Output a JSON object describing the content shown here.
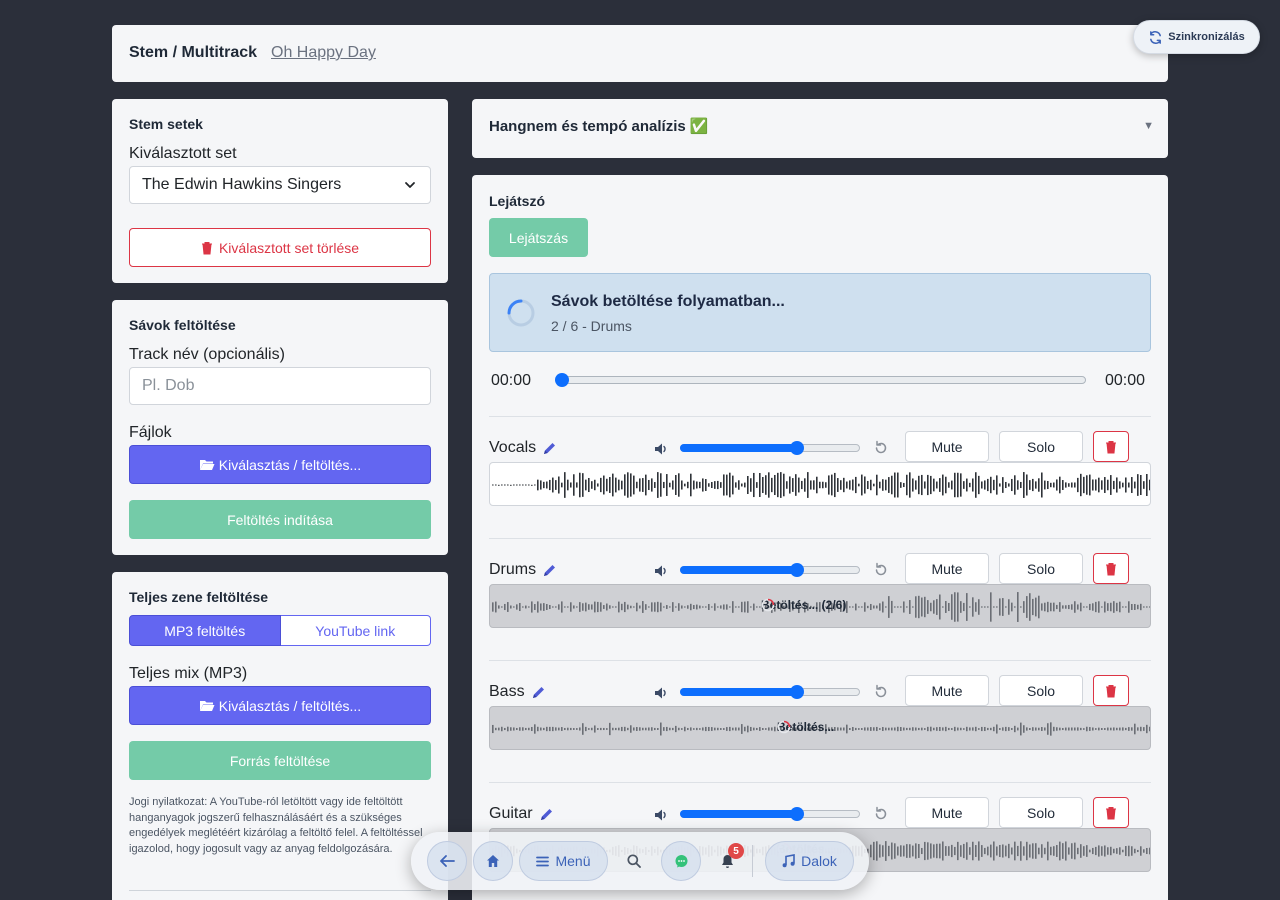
{
  "header": {
    "title": "Stem / Multitrack",
    "song": "Oh Happy Day",
    "sync_label": "Szinkronizálás"
  },
  "stem_sets": {
    "title": "Stem setek",
    "select_label": "Kiválasztott set",
    "selected_set": "The Edwin Hawkins Singers",
    "delete_label": "Kiválasztott set törlése"
  },
  "track_upload": {
    "title": "Sávok feltöltése",
    "name_label": "Track név (opcionális)",
    "name_placeholder": "Pl. Dob",
    "files_label": "Fájlok",
    "choose_label": "Kiválasztás / feltöltés...",
    "start_label": "Feltöltés indítása"
  },
  "full_upload": {
    "title": "Teljes zene feltöltése",
    "tabs": [
      "MP3 feltöltés",
      "YouTube link"
    ],
    "mix_label": "Teljes mix (MP3)",
    "choose_label": "Kiválasztás / feltöltés...",
    "source_label": "Forrás feltöltése",
    "disclaimer": "Jogi nyilatkozat: A YouTube-ról letöltött vagy ide feltöltött hanganyagok jogszerű felhasználásáért és a szükséges engedélyek meglétéért kizárólag a feltöltő felel. A feltöltéssel igazolod, hogy jogosult vagy az anyag feldolgozására."
  },
  "analysis": {
    "title": "Hangnem és tempó analízis ✅"
  },
  "player": {
    "title": "Lejátszó",
    "play_label": "Lejátszás",
    "loading_title": "Sávok betöltése folyamatban...",
    "loading_sub": "2 / 6 - Drums",
    "time_current": "00:00",
    "time_total": "00:00",
    "seek_fraction": 0.0,
    "mute_label": "Mute",
    "solo_label": "Solo",
    "tracks": [
      {
        "name": "Vocals",
        "volume": 0.65,
        "status": "",
        "loading": false
      },
      {
        "name": "Drums",
        "volume": 0.65,
        "status": "Betöltés... (2/6)",
        "loading": true
      },
      {
        "name": "Bass",
        "volume": 0.65,
        "status": "Betöltés...",
        "loading": true
      },
      {
        "name": "Guitar",
        "volume": 0.65,
        "status": "Betöltés...",
        "loading": true
      }
    ]
  },
  "nav": {
    "menu_label": "Menü",
    "songs_label": "Dalok",
    "notif_count": "5"
  },
  "colors": {
    "primary": "#6366f1",
    "success": "#74cba8",
    "danger": "#dc3545",
    "slider": "#0d6efd"
  }
}
